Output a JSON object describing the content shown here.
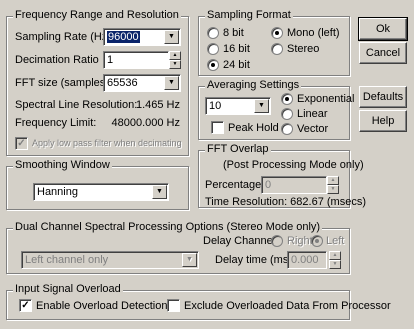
{
  "freq_group": {
    "title": "Frequency Range and Resolution",
    "sampling_rate_label": "Sampling Rate (Hz)",
    "sampling_rate_value": "96000",
    "decimation_label": "Decimation Ratio",
    "decimation_value": "1",
    "fft_size_label": "FFT size (samples)",
    "fft_size_value": "65536",
    "spectral_line_label": "Spectral Line Resolution:",
    "spectral_line_value": "1.465 Hz",
    "freq_limit_label": "Frequency Limit:",
    "freq_limit_value": "48000.000 Hz",
    "lowpass_label": "Apply low pass filter when decimating"
  },
  "sampling_format": {
    "title": "Sampling Format",
    "bit8": "8 bit",
    "bit16": "16 bit",
    "bit24": "24 bit",
    "mono": "Mono (left)",
    "stereo": "Stereo"
  },
  "averaging": {
    "title": "Averaging Settings",
    "value": "10",
    "peak_hold": "Peak Hold",
    "exponential": "Exponential",
    "linear": "Linear",
    "vector": "Vector"
  },
  "smoothing": {
    "title": "Smoothing Window",
    "value": "Hanning"
  },
  "fft_overlap": {
    "title": "FFT Overlap",
    "note": "(Post Processing Mode only)",
    "percentage_label": "Percentage:",
    "percentage_value": "0",
    "time_resolution": "Time Resolution: 682.67 (msecs)"
  },
  "dual_channel": {
    "title": "Dual Channel Spectral Processing Options (Stereo Mode only)",
    "channel_value": "Left channel only",
    "delay_channel_label": "Delay Channel:",
    "right": "Right",
    "left": "Left",
    "delay_time_label": "Delay time (msec):",
    "delay_time_value": "0.000"
  },
  "overload": {
    "title": "Input Signal Overload",
    "enable": "Enable Overload Detection",
    "exclude": "Exclude Overloaded Data From Processor"
  },
  "buttons": {
    "ok": "Ok",
    "cancel": "Cancel",
    "defaults": "Defaults",
    "help": "Help"
  }
}
